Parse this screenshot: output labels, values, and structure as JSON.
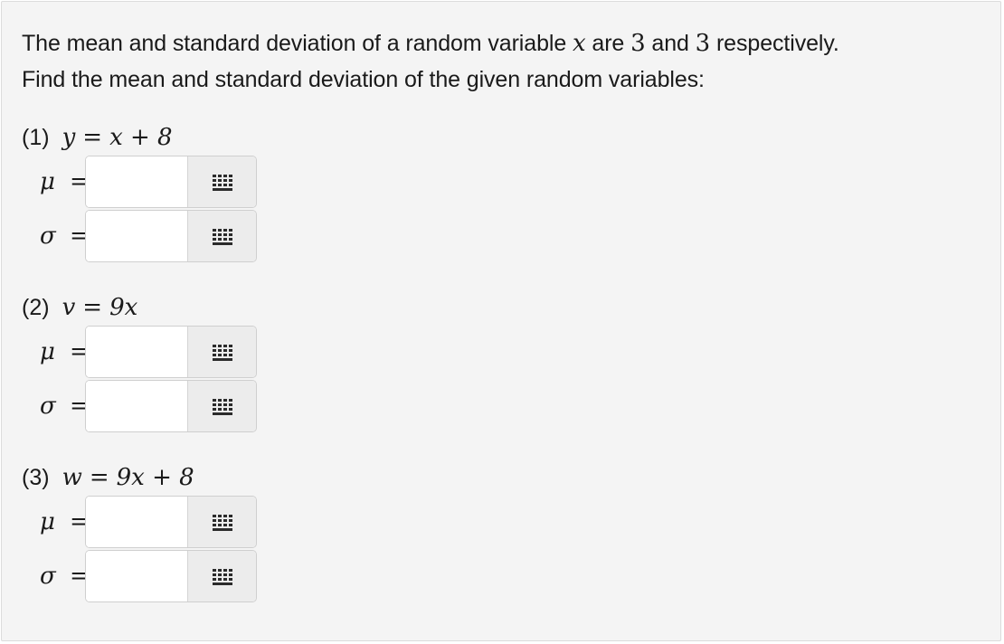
{
  "intro": {
    "line1_a": "The mean and standard deviation of a random variable ",
    "line1_var": "x",
    "line1_b": " are ",
    "mean_value": "3",
    "line1_c": " and ",
    "sd_value": "3",
    "line1_d": " respectively.",
    "line2": "Find the mean and standard deviation of the given random variables:"
  },
  "parts": [
    {
      "number": "(1)",
      "lhs": "y",
      "equals": "=",
      "rhs": "x + 8",
      "mu_symbol": "μ",
      "sigma_symbol": "σ",
      "eq_sign": "=",
      "mu_value": "",
      "sigma_value": ""
    },
    {
      "number": "(2)",
      "lhs": "v",
      "equals": "=",
      "rhs": "9x",
      "mu_symbol": "μ",
      "sigma_symbol": "σ",
      "eq_sign": "=",
      "mu_value": "",
      "sigma_value": ""
    },
    {
      "number": "(3)",
      "lhs": "w",
      "equals": "=",
      "rhs": "9x + 8",
      "mu_symbol": "μ",
      "sigma_symbol": "σ",
      "eq_sign": "=",
      "mu_value": "",
      "sigma_value": ""
    }
  ],
  "icons": {
    "keypad": "keypad-grid-icon"
  },
  "colors": {
    "panel_bg": "#f4f4f4",
    "input_bg": "#ffffff",
    "keypad_bg": "#ececec",
    "border": "#cfcfcf",
    "text": "#1a1a1a"
  }
}
